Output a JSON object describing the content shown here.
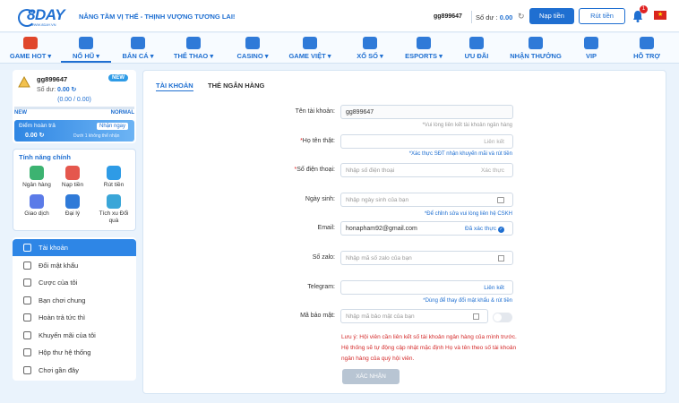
{
  "header": {
    "logo_text": "8DAY",
    "logo_sub": "WWW.8DAY.VN",
    "slogan": "NÂNG TẦM VỊ THẾ - THỊNH VƯỢNG TƯƠNG LAI!",
    "username": "gg899647",
    "balance_label": "Số dư :",
    "balance_value": "0.00",
    "deposit_label": "Nạp tiền",
    "withdraw_label": "Rút tiền",
    "notification_count": "1"
  },
  "nav": [
    {
      "label": "GAME HOT ▾",
      "icon": "fire-icon",
      "color": "#e0462b"
    },
    {
      "label": "NỔ HŨ ▾",
      "icon": "slot-machine-icon",
      "color": "#2f7ad8"
    },
    {
      "label": "BẮN CÁ ▾",
      "icon": "fish-icon",
      "color": "#2f7ad8"
    },
    {
      "label": "THỂ THAO ▾",
      "icon": "soccer-ball-icon",
      "color": "#2f7ad8"
    },
    {
      "label": "CASINO ▾",
      "icon": "casino-table-icon",
      "color": "#2f7ad8"
    },
    {
      "label": "GAME VIỆT ▾",
      "icon": "cards-icon",
      "color": "#2f7ad8"
    },
    {
      "label": "XỔ SỐ ▾",
      "icon": "lottery-icon",
      "color": "#2f7ad8"
    },
    {
      "label": "ESPORTS ▾",
      "icon": "gamepad-icon",
      "color": "#2f7ad8"
    },
    {
      "label": "ƯU ĐÃI",
      "icon": "gift-icon",
      "color": "#2f7ad8"
    },
    {
      "label": "NHẬN THƯỞNG",
      "icon": "reward-icon",
      "color": "#2f7ad8"
    },
    {
      "label": "VIP",
      "icon": "crown-icon",
      "color": "#2f7ad8"
    },
    {
      "label": "HỖ TRỢ",
      "icon": "support-icon",
      "color": "#2f7ad8"
    }
  ],
  "account": {
    "name": "gg899647",
    "balance_label": "Số dư:",
    "balance_value": "0.00 ↻",
    "new_badge": "NEW",
    "values": "(0.00 / 0.00)",
    "level_left": "NEW",
    "level_right": "NORMAL",
    "level_progress": 0.0,
    "rebate_title": "Điểm hoàn trả",
    "rebate_value": "0.00 ↻",
    "rebate_button": "Nhận ngay",
    "rebate_note": "Dưới 1 không thể nhận"
  },
  "features": {
    "title": "Tính năng chính",
    "items": [
      {
        "label": "Ngân hàng",
        "icon": "bank-icon",
        "color": "#3cb371"
      },
      {
        "label": "Nạp tiền",
        "icon": "deposit-icon",
        "color": "#e5574d"
      },
      {
        "label": "Rút tiền",
        "icon": "withdraw-icon",
        "color": "#2e9be6"
      },
      {
        "label": "Giao dịch",
        "icon": "transaction-icon",
        "color": "#5b7be8"
      },
      {
        "label": "Đại lý",
        "icon": "agent-icon",
        "color": "#2f7ad8"
      },
      {
        "label": "Tích xu Đổi quà",
        "icon": "coin-gift-icon",
        "color": "#3aa6d8"
      }
    ]
  },
  "menu": [
    {
      "label": "Tài khoản",
      "icon": "user-icon"
    },
    {
      "label": "Đổi mật khẩu",
      "icon": "lock-icon"
    },
    {
      "label": "Cược của tôi",
      "icon": "bet-slip-icon"
    },
    {
      "label": "Bạn chơi chung",
      "icon": "friends-icon"
    },
    {
      "label": "Hoàn trả tức thì",
      "icon": "refund-icon"
    },
    {
      "label": "Khuyến mãi của tôi",
      "icon": "promotion-icon"
    },
    {
      "label": "Hộp thư hệ thống",
      "icon": "mailbox-icon"
    },
    {
      "label": "Chơi gần đây",
      "icon": "clock-icon"
    }
  ],
  "tabs": {
    "account": "TÀI KHOẢN",
    "bank": "THẺ NGÂN HÀNG"
  },
  "form": {
    "username_label": "Tên tài khoản:",
    "username_value": "gg899647",
    "username_hint": "*Vui lòng liên kết tài khoản ngân hàng",
    "fullname_label": "Họ tên thật:",
    "fullname_action": "Liên kết",
    "fullname_hint": "*Xác thực SĐT nhận khuyến mãi và rút tiền",
    "phone_label": "Số điện thoại:",
    "phone_placeholder": "Nhập số điện thoại",
    "phone_action": "Xác thực",
    "birth_label": "Ngày sinh:",
    "birth_placeholder": "Nhập ngày sinh của bạn",
    "birth_hint": "*Để chỉnh sửa vui lòng liên hệ CSKH",
    "email_label": "Email:",
    "email_value": "honapham92@gmail.com",
    "email_status": "Đã xác thực",
    "zalo_label": "Số zalo:",
    "zalo_placeholder": "Nhập mã số zalo của bạn",
    "telegram_label": "Telegram:",
    "telegram_action": "Liên kết",
    "telegram_hint": "*Dùng để thay đổi mật khẩu & rút tiền",
    "secret_label": "Mã bảo mật:",
    "secret_placeholder": "Nhập mã bảo mật của bạn",
    "warning": "Lưu ý: Hội viên cần liên kết số tài khoản ngân hàng của mình trước. Hệ thống sẽ tự động cập nhật mặc định Họ và tên theo số tài khoản ngân hàng của quý hội viên.",
    "submit_label": "XÁC NHẬN"
  }
}
